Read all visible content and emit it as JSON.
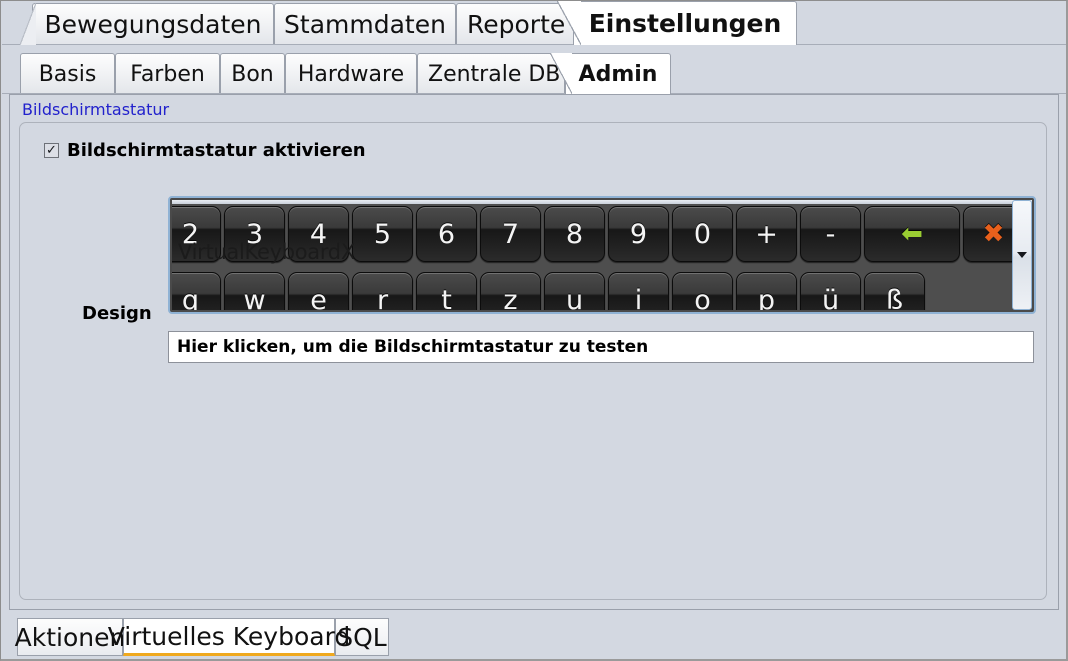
{
  "window": {
    "background_color": "#d3d8e1",
    "border_color": "#8d8d8d"
  },
  "main_tabs": {
    "items": [
      {
        "label": "Bewegungsdaten",
        "active": false
      },
      {
        "label": "Stammdaten",
        "active": false
      },
      {
        "label": "Reporte",
        "active": false
      },
      {
        "label": "Einstellungen",
        "active": true
      }
    ]
  },
  "sub_tabs": {
    "items": [
      {
        "label": "Basis",
        "active": false
      },
      {
        "label": "Farben",
        "active": false
      },
      {
        "label": "Bon",
        "active": false
      },
      {
        "label": "Hardware",
        "active": false
      },
      {
        "label": "Zentrale DB",
        "active": false
      },
      {
        "label": "Admin",
        "active": true
      }
    ]
  },
  "content": {
    "section_label": "Bildschirmtastatur",
    "section_label_color": "#2222cc",
    "enable_checkbox": {
      "label": "Bildschirmtastatur aktivieren",
      "checked": true,
      "check_glyph": "✓"
    },
    "design": {
      "field_label": "Design",
      "selected_value": "VirtualKeyboardX",
      "dropdown_arrow": "▼"
    },
    "keyboard_preview": {
      "row1": [
        {
          "label": "2",
          "kind": "char"
        },
        {
          "label": "3",
          "kind": "char"
        },
        {
          "label": "4",
          "kind": "char"
        },
        {
          "label": "5",
          "kind": "char"
        },
        {
          "label": "6",
          "kind": "char"
        },
        {
          "label": "7",
          "kind": "char"
        },
        {
          "label": "8",
          "kind": "char"
        },
        {
          "label": "9",
          "kind": "char"
        },
        {
          "label": "0",
          "kind": "char"
        },
        {
          "label": "+",
          "kind": "char"
        },
        {
          "label": "-",
          "kind": "char"
        },
        {
          "label": "⬅",
          "kind": "backspace"
        },
        {
          "label": "✖",
          "kind": "close"
        }
      ],
      "row2": [
        {
          "label": "q",
          "kind": "char"
        },
        {
          "label": "w",
          "kind": "char"
        },
        {
          "label": "e",
          "kind": "char"
        },
        {
          "label": "r",
          "kind": "char"
        },
        {
          "label": "t",
          "kind": "char"
        },
        {
          "label": "z",
          "kind": "char"
        },
        {
          "label": "u",
          "kind": "char"
        },
        {
          "label": "i",
          "kind": "char"
        },
        {
          "label": "o",
          "kind": "char"
        },
        {
          "label": "p",
          "kind": "char"
        },
        {
          "label": "ü",
          "kind": "char"
        },
        {
          "label": "ß",
          "kind": "char"
        }
      ],
      "backspace_color": "#9acd32",
      "close_color": "#e8601c",
      "key_surface_color": "#2b2b2b"
    },
    "test_field": {
      "value": "Hier klicken, um die Bildschirmtastatur zu testen",
      "placeholder": "Hier klicken, um die Bildschirmtastatur zu testen"
    }
  },
  "bottom_tabs": {
    "items": [
      {
        "label": "Aktionen",
        "active": false
      },
      {
        "label": "Virtuelles Keyboard",
        "active": true
      },
      {
        "label": "SQL",
        "active": false
      }
    ],
    "active_underline_color": "#f0a91e"
  }
}
